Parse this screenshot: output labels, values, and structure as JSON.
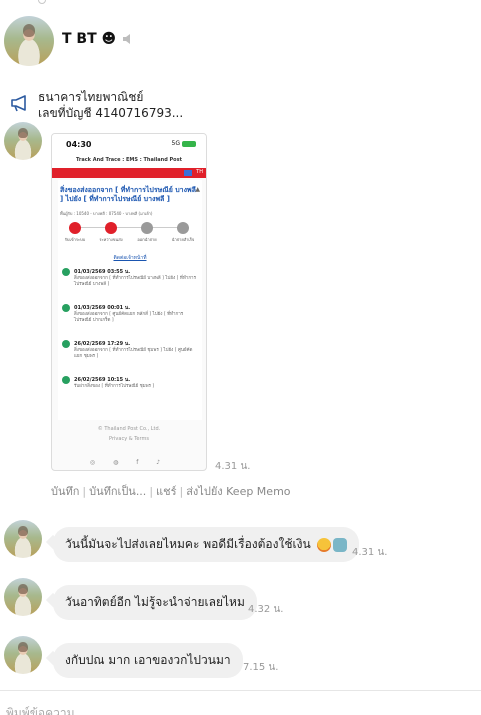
{
  "chat": {
    "name": "T BT ☻"
  },
  "announcement": {
    "title": "ธนาคารไทยพาณิชย์",
    "subtitle": "เลขที่บัญชี 4140716793..."
  },
  "screenshot": {
    "status_time": "04:30",
    "signal_text": "5G",
    "app_title": "Track And Trace : EMS : Thailand Post",
    "lang": "TH",
    "route": "สิ่งของส่งออกจาก [ ที่ทำการไปรษณีย์ บางพลี ] ไปยัง [ ที่ทำการไปรษณีย์ บางพลี ]",
    "meta": "พื้นผู้รับ : 10540 - บางพลี : 07540 - บางพลี (มาเย้า)",
    "steps": [
      "รับเข้าระบบ",
      "ระหว่างขนส่ง",
      "ออกนำจ่าย",
      "นำจ่ายสำเร็จ"
    ],
    "contact": "ติดต่อเจ้าหน้าที่",
    "events": [
      {
        "time": "01/03/2569 03:55 น.",
        "desc": "สิ่งของส่งออกจาก [ ที่ทำการไปรษณีย์ บางพลี ] ไปยัง [ ที่ทำการไปรษณีย์ บางพลี ]"
      },
      {
        "time": "01/03/2569 00:01 น.",
        "desc": "สิ่งของส่งออกจาก [ ศูนย์คัดแยก หลักสี่ ] ไปยัง [ ที่ทำการไปรษณีย์ ปากเกร็ด ]"
      },
      {
        "time": "26/02/2569 17:29 น.",
        "desc": "สิ่งของส่งออกจาก [ ที่ทำการไปรษณีย์ ชุมพร ] ไปยัง [ ศูนย์คัดแยก ชุมพร ]"
      },
      {
        "time": "26/02/2569 10:15 น.",
        "desc": "รับฝากสิ่งของ [ ที่ทำการไปรษณีย์ ชุมพร ]"
      }
    ],
    "footer_copyright": "© Thailand Post Co., Ltd.",
    "footer_privacy": "Privacy & Terms",
    "footer_icons": "◎ ◍ f  ♪"
  },
  "messages": [
    {
      "image_time": "4.31 น."
    },
    {
      "text": "วันนี้มันจะไปส่งเลยไหมคะ พอดีมีเรื่องต้องใช้เงิน",
      "time": "4.31 น."
    },
    {
      "text": "วันอาทิตย์อีก ไม่รู้จะนำจ่ายเลยไหม",
      "time": "4.32 น."
    },
    {
      "text": "งกับปณ มาก เอาของวกไปวนมา",
      "time": "7.15 น."
    }
  ],
  "image_actions": [
    "บันทึก",
    "บันทึกเป็น...",
    "แชร์",
    "ส่งไปยัง Keep Memo"
  ],
  "input": {
    "placeholder": "พิมพ์ข้อความ"
  }
}
